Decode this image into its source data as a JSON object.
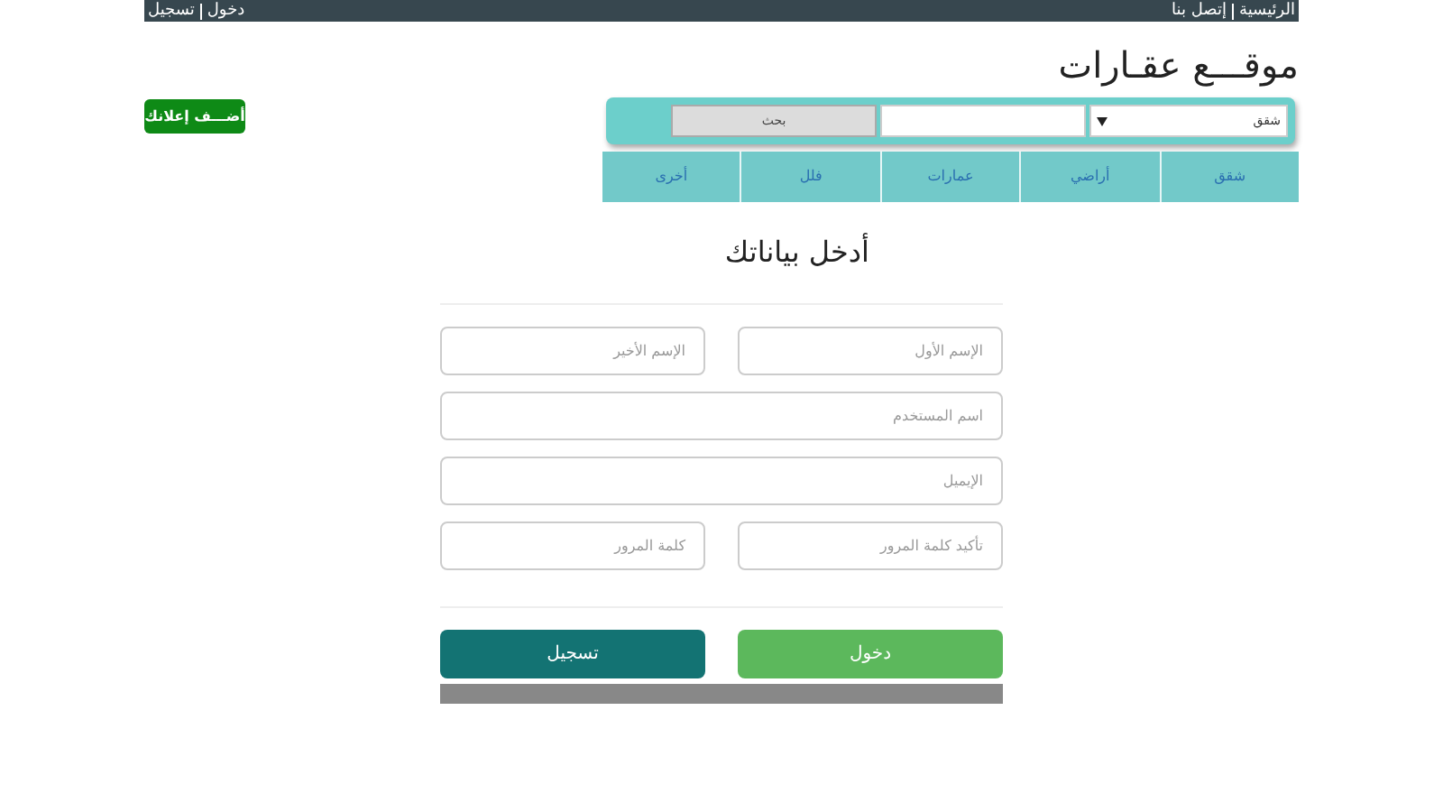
{
  "top_bar": {
    "right_links": [
      "الرئيسية",
      "إتصل بنا"
    ],
    "left_links": [
      "دخول",
      "تسجيل"
    ]
  },
  "site_title": "موقـــع عقـارات",
  "add_ad_button": "أضـــف إعلانك",
  "search": {
    "category_value": "شقق",
    "search_button": "بحث"
  },
  "categories": [
    "شقق",
    "أراضي",
    "عمارات",
    "فلل",
    "أخرى"
  ],
  "form": {
    "heading": "أدخل بياناتك",
    "fields": [
      {
        "placeholder": "الإسم الأول",
        "kind": "half"
      },
      {
        "placeholder": "الإسم الأخير",
        "kind": "half"
      },
      {
        "placeholder": "اسم المستخدم",
        "kind": "full"
      },
      {
        "placeholder": "الإيميل",
        "kind": "full"
      },
      {
        "placeholder": "تأكيد كلمة المرور",
        "kind": "half"
      },
      {
        "placeholder": "كلمة المرور",
        "kind": "half"
      }
    ],
    "buttons": [
      {
        "label": "دخول",
        "kind": "login"
      },
      {
        "label": "تسجيل",
        "kind": "register"
      }
    ]
  }
}
